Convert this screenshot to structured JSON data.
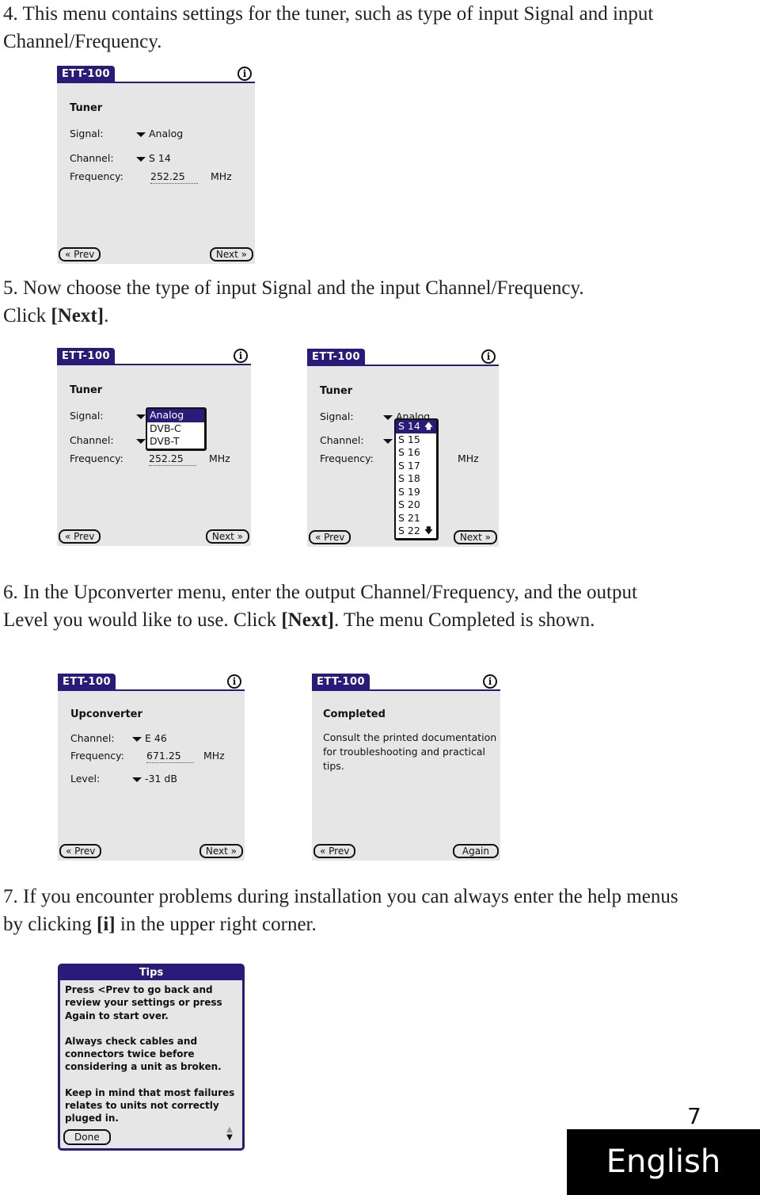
{
  "steps": {
    "step4": {
      "text": "4. This menu contains settings for the tuner, such as type of input Signal and input Channel/Frequency."
    },
    "step5": {
      "pre": "5. Now choose the type of input Signal and the input Channel/Frequency.  Click ",
      "action": "[Next]",
      "post": "."
    },
    "step6": {
      "pre": "6. In the Upconverter menu, enter the output Channel/Frequency, and the output Level you would like to use. Click ",
      "action": "[Next]",
      "post": ". The menu Completed is shown."
    },
    "step7": {
      "pre": "7. If you encounter problems during installation you can always enter the help menus by clicking ",
      "action": "[i]",
      "post": " in the upper right corner."
    }
  },
  "app": {
    "title": "ETT-100",
    "info_icon": "i",
    "prev_label": "« Prev",
    "next_label": "Next »",
    "again_label": "Again"
  },
  "tuner": {
    "heading": "Tuner",
    "signal_label": "Signal:",
    "signal_value": "Analog",
    "channel_label": "Channel:",
    "channel_value": "S 14",
    "frequency_label": "Frequency:",
    "frequency_value": "252.25",
    "frequency_unit": "MHz"
  },
  "signal_popup": {
    "options": [
      "Analog",
      "DVB-C",
      "DVB-T"
    ],
    "selected": "Analog"
  },
  "channel_popup": {
    "options": [
      "S 14",
      "S 15",
      "S 16",
      "S 17",
      "S 18",
      "S 19",
      "S 20",
      "S 21",
      "S 22"
    ],
    "selected": "S 14",
    "scroll_up": "🡅",
    "scroll_down": "🡇"
  },
  "upconverter": {
    "heading": "Upconverter",
    "channel_label": "Channel:",
    "channel_value": "E 46",
    "frequency_label": "Frequency:",
    "frequency_value": "671.25",
    "frequency_unit": "MHz",
    "level_label": "Level:",
    "level_value": "-31 dB"
  },
  "completed": {
    "heading": "Completed",
    "text": "Consult the printed documentation for troubleshooting and practical tips."
  },
  "tips": {
    "title": "Tips",
    "paragraphs": [
      "Press <Prev to go back and review your settings or press Again to start over.",
      "Always check cables and connectors twice before considering a unit as broken.",
      "Keep in mind that most failures relates to units not correctly pluged in."
    ],
    "done_label": "Done"
  },
  "footer": {
    "page_number": "7",
    "language": "English"
  },
  "colors": {
    "palm_title": "#2a1a7a",
    "palm_bg": "#e6e6e6"
  }
}
